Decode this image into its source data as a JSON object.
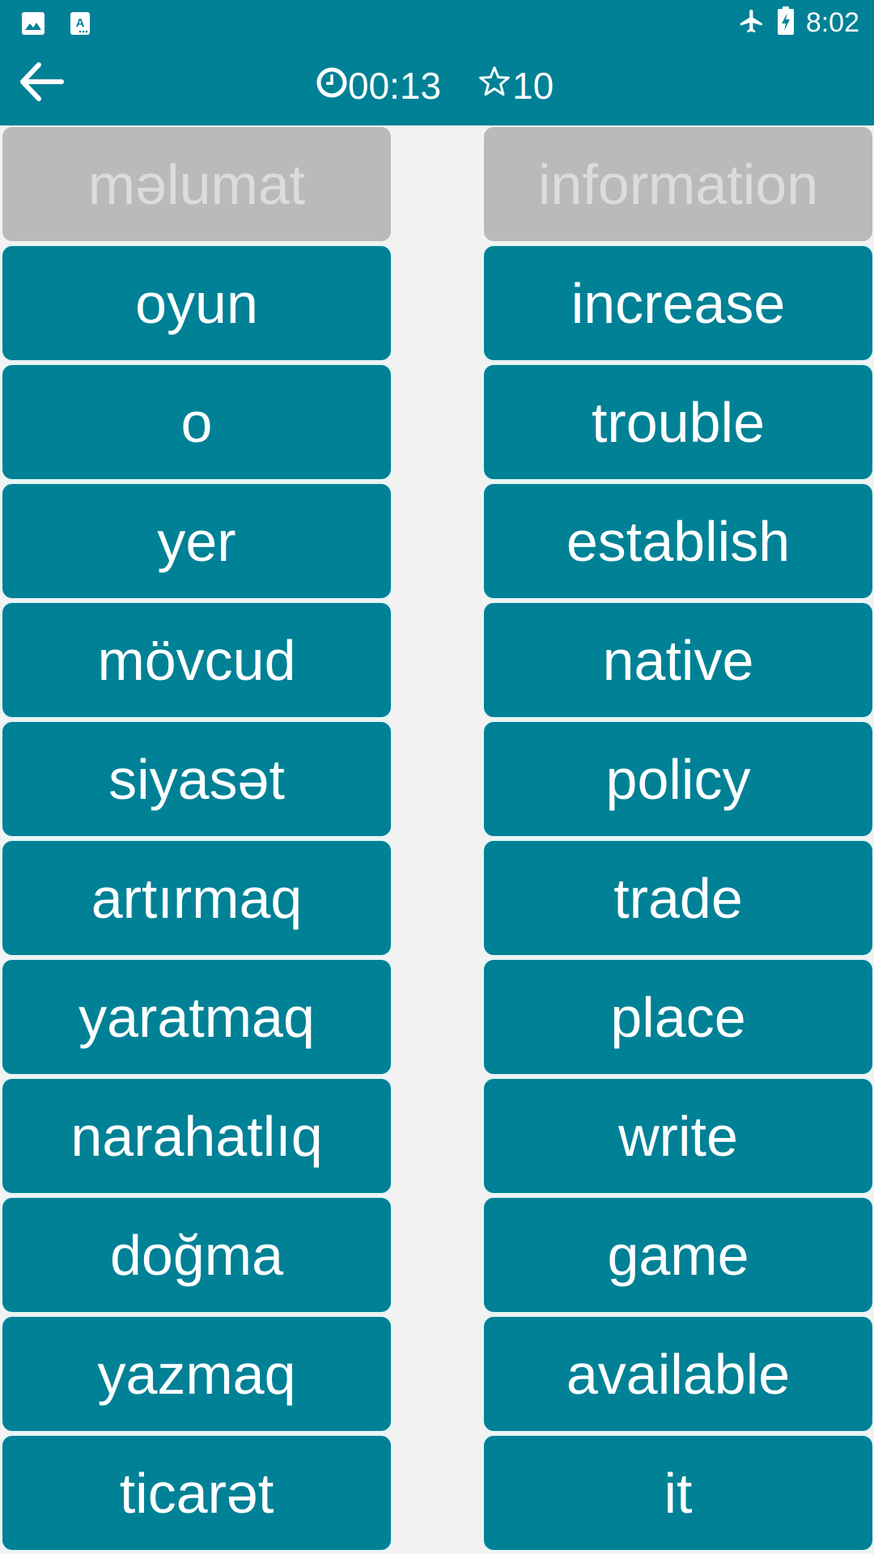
{
  "colors": {
    "primary": "#008196",
    "background": "#f2f2f2",
    "tile_disabled": "#bababa",
    "tile_disabled_text": "#dcdcdc",
    "tile_text": "#ffffff"
  },
  "status_bar": {
    "left_icons": [
      "image-icon",
      "text-format-icon"
    ],
    "right_icons": [
      "airplane-mode-icon",
      "battery-charging-icon"
    ],
    "time": "8:02"
  },
  "app_bar": {
    "back_icon": "arrow-left-icon",
    "timer_icon": "clock-icon",
    "timer": "00:13",
    "score_icon": "star-outline-icon",
    "score": "10"
  },
  "left_column": [
    {
      "label": "məlumat",
      "state": "matched"
    },
    {
      "label": "oyun",
      "state": "active"
    },
    {
      "label": "o",
      "state": "active"
    },
    {
      "label": "yer",
      "state": "active"
    },
    {
      "label": "mövcud",
      "state": "active"
    },
    {
      "label": "siyasət",
      "state": "active"
    },
    {
      "label": "artırmaq",
      "state": "active"
    },
    {
      "label": "yaratmaq",
      "state": "active"
    },
    {
      "label": "narahatlıq",
      "state": "active"
    },
    {
      "label": "doğma",
      "state": "active"
    },
    {
      "label": "yazmaq",
      "state": "active"
    },
    {
      "label": "ticarət",
      "state": "active"
    }
  ],
  "right_column": [
    {
      "label": "information",
      "state": "matched"
    },
    {
      "label": "increase",
      "state": "active"
    },
    {
      "label": "trouble",
      "state": "active"
    },
    {
      "label": "establish",
      "state": "active"
    },
    {
      "label": "native",
      "state": "active"
    },
    {
      "label": "policy",
      "state": "active"
    },
    {
      "label": "trade",
      "state": "active"
    },
    {
      "label": "place",
      "state": "active"
    },
    {
      "label": "write",
      "state": "active"
    },
    {
      "label": "game",
      "state": "active"
    },
    {
      "label": "available",
      "state": "active"
    },
    {
      "label": "it",
      "state": "active"
    }
  ]
}
